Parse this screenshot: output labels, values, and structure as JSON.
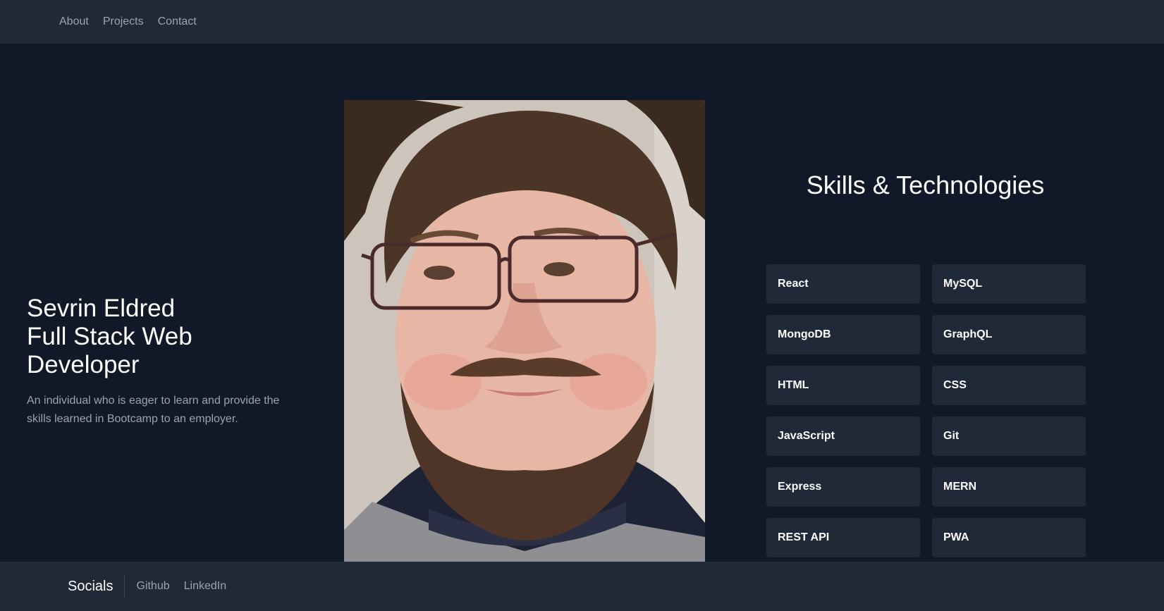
{
  "nav": {
    "items": [
      {
        "label": "About"
      },
      {
        "label": "Projects"
      },
      {
        "label": "Contact"
      }
    ]
  },
  "intro": {
    "name_line1": "Sevrin Eldred",
    "name_line2": "Full Stack Web",
    "name_line3": "Developer",
    "description": "An individual who is eager to learn and provide the skills learned in Bootcamp to an employer."
  },
  "skills": {
    "title": "Skills & Technologies",
    "items": [
      {
        "label": "React"
      },
      {
        "label": "MySQL"
      },
      {
        "label": "MongoDB"
      },
      {
        "label": "GraphQL"
      },
      {
        "label": "HTML"
      },
      {
        "label": "CSS"
      },
      {
        "label": "JavaScript"
      },
      {
        "label": "Git"
      },
      {
        "label": "Express"
      },
      {
        "label": "MERN"
      },
      {
        "label": "REST API"
      },
      {
        "label": "PWA"
      }
    ]
  },
  "footer": {
    "title": "Socials",
    "links": [
      {
        "label": "Github"
      },
      {
        "label": "LinkedIn"
      }
    ]
  },
  "colors": {
    "background": "#111827",
    "panel": "#1f2937",
    "text_primary": "#ffffff",
    "text_muted": "#9ca3af"
  }
}
